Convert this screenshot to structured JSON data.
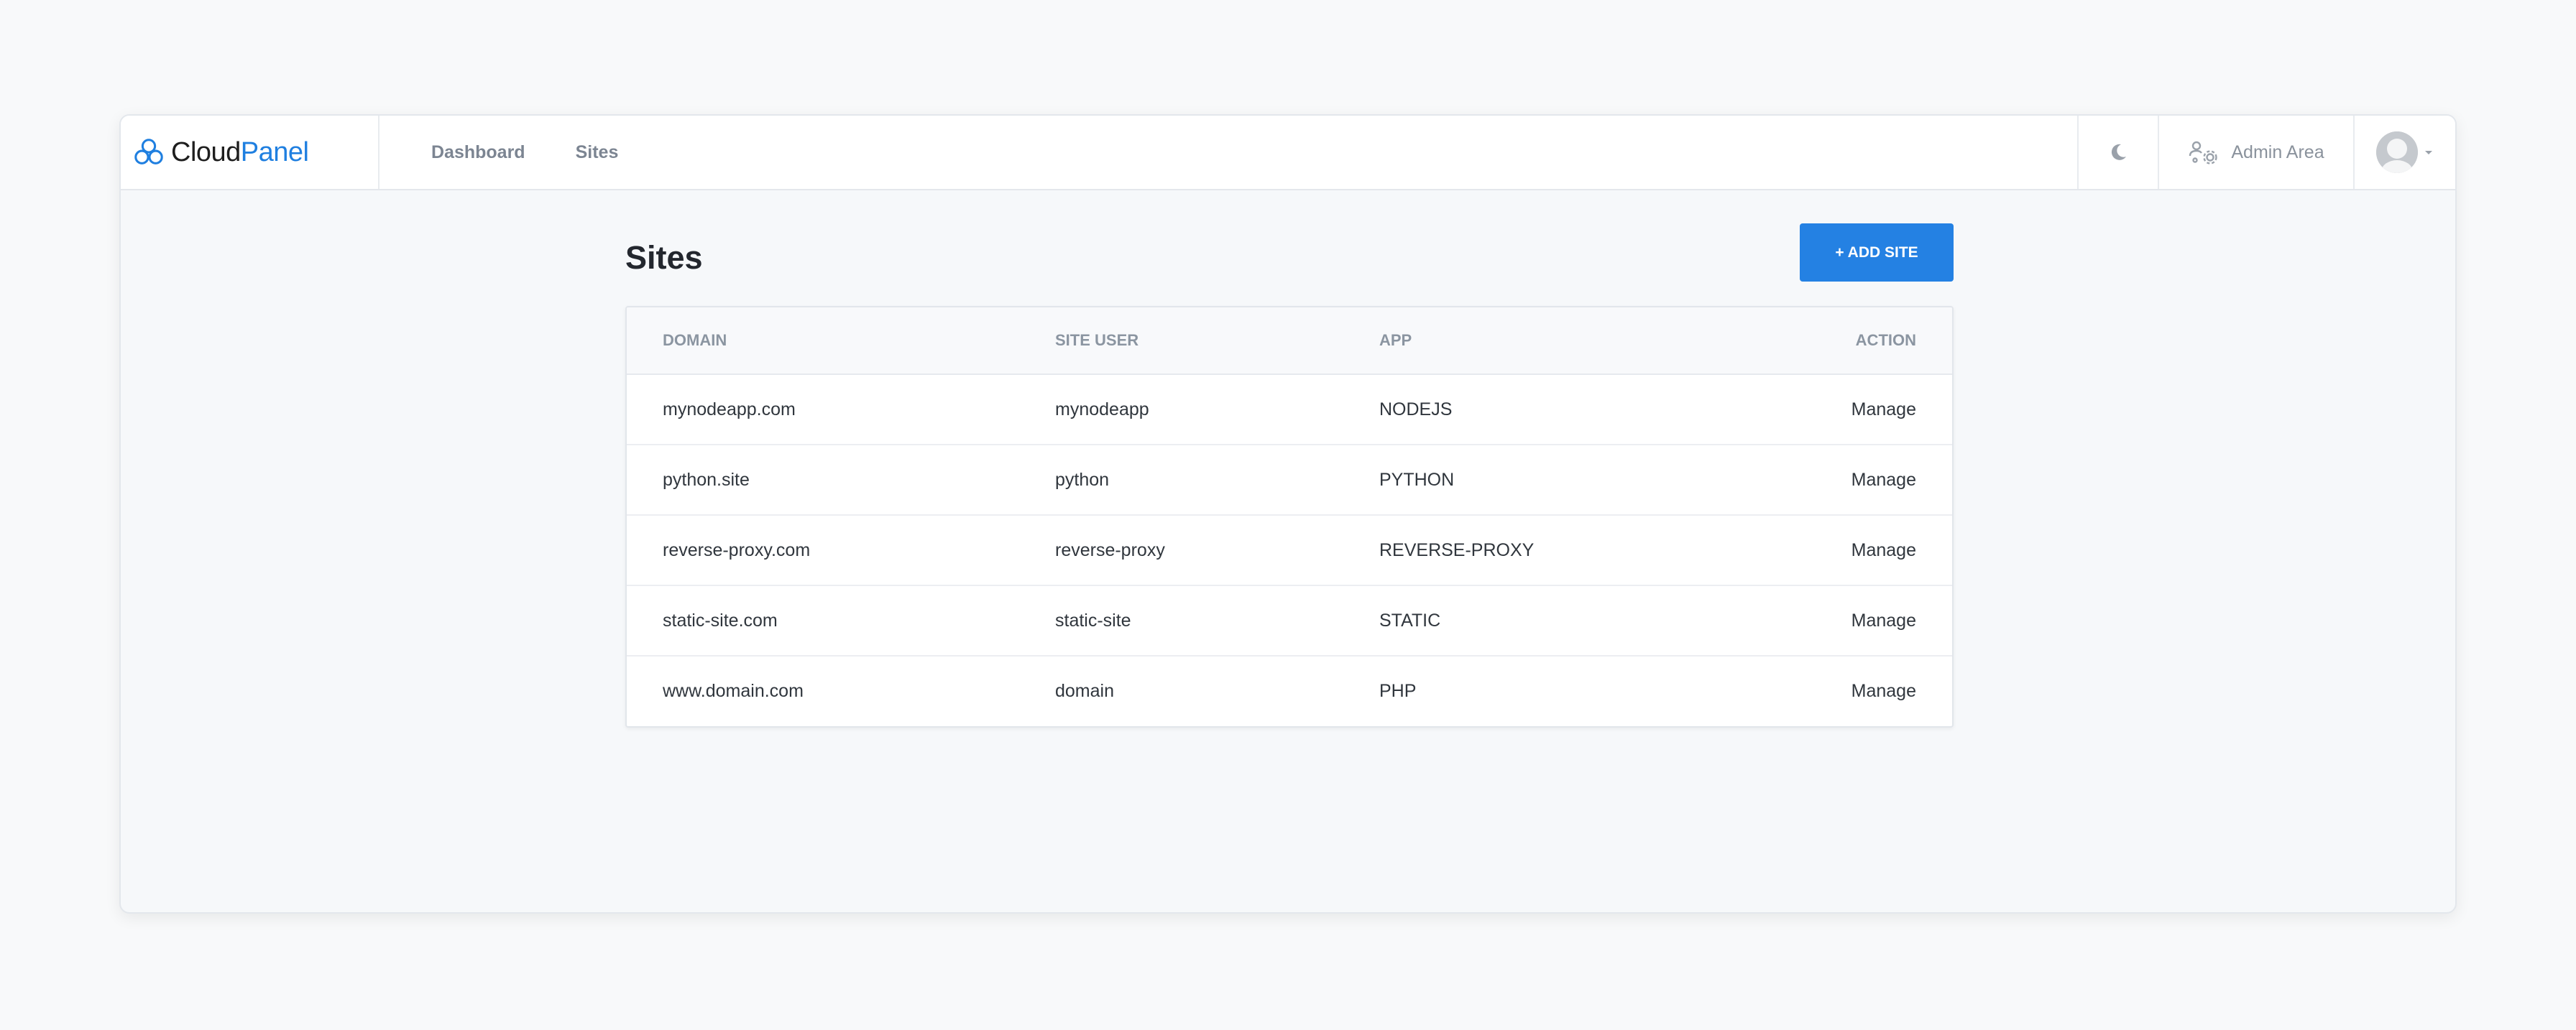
{
  "app": {
    "brand_cloud": "Cloud",
    "brand_panel": "Panel"
  },
  "nav": {
    "items": [
      {
        "label": "Dashboard"
      },
      {
        "label": "Sites"
      }
    ]
  },
  "topbar": {
    "theme_icon": "moon-icon",
    "admin_icon": "users-gear-icon",
    "admin_label": "Admin Area",
    "user_icon": "avatar"
  },
  "page": {
    "title": "Sites",
    "add_button_label": "+ ADD SITE"
  },
  "table": {
    "columns": [
      "DOMAIN",
      "SITE USER",
      "APP",
      "ACTION"
    ],
    "rows": [
      {
        "domain": "mynodeapp.com",
        "site_user": "mynodeapp",
        "app": "NODEJS",
        "action": "Manage"
      },
      {
        "domain": "python.site",
        "site_user": "python",
        "app": "PYTHON",
        "action": "Manage"
      },
      {
        "domain": "reverse-proxy.com",
        "site_user": "reverse-proxy",
        "app": "REVERSE-PROXY",
        "action": "Manage"
      },
      {
        "domain": "static-site.com",
        "site_user": "static-site",
        "app": "STATIC",
        "action": "Manage"
      },
      {
        "domain": "www.domain.com",
        "site_user": "domain",
        "app": "PHP",
        "action": "Manage"
      }
    ]
  },
  "colors": {
    "accent": "#2481e3",
    "brand_blue": "#1f7fe0",
    "background": "#f8f9fa"
  }
}
